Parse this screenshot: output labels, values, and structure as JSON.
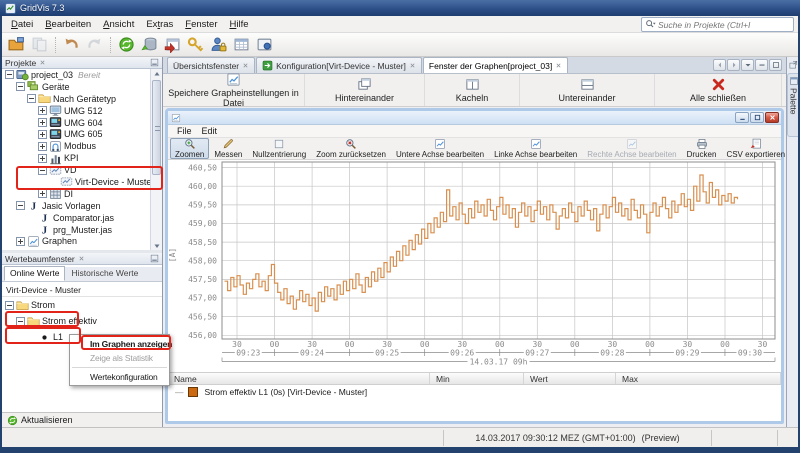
{
  "window": {
    "title": "GridVis 7.3"
  },
  "menubar": {
    "items": [
      {
        "label": "Datei",
        "accel": 0
      },
      {
        "label": "Bearbeiten",
        "accel": 0
      },
      {
        "label": "Ansicht",
        "accel": 0
      },
      {
        "label": "Extras",
        "accel": 2
      },
      {
        "label": "Fenster",
        "accel": 0
      },
      {
        "label": "Hilfe",
        "accel": 0
      }
    ]
  },
  "search": {
    "placeholder": "Suche in Projekte (Ctrl+I"
  },
  "main_toolbar": {
    "groups": [
      2,
      2,
      7
    ],
    "items": [
      {
        "name": "open-project",
        "icon": "open-project"
      },
      {
        "name": "copy",
        "icon": "copy",
        "disabled": true
      },
      {
        "name": "undo",
        "icon": "undo"
      },
      {
        "name": "redo",
        "icon": "redo",
        "disabled": true
      },
      {
        "name": "refresh",
        "icon": "refresh"
      },
      {
        "name": "db-sync",
        "icon": "dbsync"
      },
      {
        "name": "import-window",
        "icon": "importwin"
      },
      {
        "name": "key",
        "icon": "key"
      },
      {
        "name": "user-lock",
        "icon": "userlock"
      },
      {
        "name": "table",
        "icon": "tableicon"
      },
      {
        "name": "panel",
        "icon": "panelicon"
      }
    ]
  },
  "projekte_panel": {
    "title": "Projekte",
    "tree": [
      {
        "label": "project_03",
        "suffix": "Bereit",
        "icon": "project",
        "depth": 0,
        "expander": "minus"
      },
      {
        "label": "Geräte",
        "icon": "devices",
        "depth": 1,
        "expander": "minus"
      },
      {
        "label": "Nach Gerätetyp",
        "icon": "folder",
        "depth": 2,
        "expander": "minus"
      },
      {
        "label": "UMG 512",
        "icon": "monitor",
        "depth": 3,
        "expander": "plus"
      },
      {
        "label": "UMG 604",
        "icon": "umg",
        "depth": 3,
        "expander": "plus"
      },
      {
        "label": "UMG 605",
        "icon": "umg",
        "depth": 3,
        "expander": "plus"
      },
      {
        "label": "Modbus",
        "icon": "modbus",
        "depth": 3,
        "expander": "plus"
      },
      {
        "label": "KPI",
        "icon": "kpi",
        "depth": 3,
        "expander": "plus"
      },
      {
        "label": "VD",
        "icon": "vd",
        "depth": 3,
        "expander": "minus",
        "highlight": true
      },
      {
        "label": "Virt-Device - Muster",
        "icon": "vd",
        "depth": 4,
        "highlight": true
      },
      {
        "label": "DI",
        "icon": "di",
        "depth": 3,
        "expander": "plus"
      },
      {
        "label": "Jasic Vorlagen",
        "icon": "jasic",
        "depth": 1,
        "expander": "minus"
      },
      {
        "label": "Comparator.jas",
        "icon": "jasic",
        "depth": 2
      },
      {
        "label": "prg_Muster.jas",
        "icon": "jasic",
        "depth": 2
      },
      {
        "label": "Graphen",
        "icon": "chartpage",
        "depth": 1,
        "expander": "plus"
      }
    ]
  },
  "werte_panel": {
    "title": "Wertebaumfenster",
    "tabs": [
      "Online Werte",
      "Historische Werte"
    ],
    "active_tab": 0,
    "device_label": "Virt-Device - Muster",
    "tree": [
      {
        "label": "Strom",
        "icon": "folder",
        "depth": 0,
        "expander": "minus"
      },
      {
        "label": "Strom effektiv",
        "icon": "folder",
        "depth": 1,
        "expander": "minus",
        "highlight": true
      },
      {
        "label": "L1",
        "icon": "dot",
        "depth": 2,
        "highlight": true
      }
    ],
    "refresh_button": "Aktualisieren"
  },
  "context_menu": {
    "items": [
      {
        "label": "Im Graphen anzeigen",
        "bold": true,
        "highlight": true
      },
      {
        "label": "Zeige als Statistik",
        "disabled": true
      },
      {
        "sep": true
      },
      {
        "label": "Wertekonfiguration"
      }
    ]
  },
  "doc_tabs": [
    {
      "label": "Übersichtsfenster"
    },
    {
      "label": "Konfiguration[Virt-Device - Muster]",
      "icon": "config"
    },
    {
      "label": "Fenster der Graphen[project_03]",
      "active": true
    }
  ],
  "tab_controls": [
    {
      "name": "scroll-tabs-left",
      "icon": "trileft"
    },
    {
      "name": "scroll-tabs-right",
      "icon": "triright"
    },
    {
      "name": "tab-list-dropdown",
      "icon": "tridown"
    },
    {
      "name": "minimize-group",
      "icon": "dash"
    },
    {
      "name": "maximize-group",
      "icon": "maxi"
    }
  ],
  "graph_actions": [
    {
      "label": "Speichere Grapheinstellungen in Datei",
      "icon": "chartpage"
    },
    {
      "label": "Hintereinander",
      "icon": "cascade"
    },
    {
      "label": "Kacheln",
      "icon": "tile"
    },
    {
      "label": "Untereinander",
      "icon": "hsplit"
    },
    {
      "label": "Alle schließen",
      "icon": "closered"
    }
  ],
  "graph_window": {
    "menu": [
      "File",
      "Edit"
    ],
    "toolbar": [
      {
        "label": "Zoomen",
        "icon": "zoomin",
        "pressed": true
      },
      {
        "label": "Messen",
        "icon": "measure"
      },
      {
        "label": "Nullzentrierung",
        "icon": "checkbox"
      },
      {
        "label": "Zoom zurücksetzen",
        "icon": "zoomreset"
      },
      {
        "label": "Untere Achse bearbeiten",
        "icon": "axis"
      },
      {
        "label": "Linke Achse bearbeiten",
        "icon": "axis"
      },
      {
        "label": "Rechte Achse bearbeiten",
        "icon": "axis",
        "disabled": true
      },
      {
        "label": "Drucken",
        "icon": "print"
      },
      {
        "label": "CSV exportieren",
        "icon": "csv"
      }
    ],
    "table": {
      "columns": [
        "Name",
        "Min",
        "Wert",
        "Max"
      ],
      "rows": [
        {
          "name": "Strom effektiv L1 (0s) [Virt-Device - Muster]",
          "swatch": "#cb6a10",
          "min": "",
          "wert": "",
          "max": ""
        }
      ]
    }
  },
  "chart_data": {
    "type": "line",
    "line_style": "step-after",
    "ylabel": "[A]",
    "ylim": [
      455.9,
      460.65
    ],
    "y_ticks": [
      456.0,
      456.5,
      457.0,
      457.5,
      458.0,
      458.5,
      459.0,
      459.5,
      460.0,
      460.5
    ],
    "x_start": "09:23:18",
    "x_end": "09:30:40",
    "x_minor_tick_labels": [
      "30",
      "00",
      "30",
      "00",
      "30",
      "00",
      "30",
      "00",
      "30",
      "00",
      "30",
      "00",
      "30",
      "00",
      "30"
    ],
    "x_minute_labels": [
      "09:23",
      "09:24",
      "09:25",
      "09:26",
      "09:27",
      "09:28",
      "09:29",
      "09:30"
    ],
    "x_date_label": "14.03.17 09h",
    "grid": true,
    "series": [
      {
        "name": "Strom effektiv L1 (0s) [Virt-Device - Muster]",
        "color": "#d79050",
        "start": "09:23:20",
        "interval_s": 2.5,
        "values": [
          457.45,
          457.2,
          457.55,
          457.3,
          457.6,
          457.35,
          457.1,
          457.4,
          457.25,
          457.5,
          457.65,
          457.3,
          457.45,
          457.2,
          457.6,
          457.9,
          457.4,
          457.15,
          456.95,
          457.25,
          456.85,
          457.05,
          456.7,
          456.95,
          457.2,
          456.9,
          457.1,
          456.8,
          457.0,
          456.65,
          457.15,
          456.9,
          457.3,
          457.05,
          457.25,
          456.95,
          457.35,
          457.1,
          457.45,
          457.2,
          457.5,
          457.25,
          457.65,
          457.35,
          457.15,
          457.55,
          457.3,
          457.7,
          457.45,
          457.8,
          457.55,
          457.95,
          457.7,
          458.1,
          457.85,
          458.25,
          458.0,
          458.4,
          458.15,
          458.55,
          458.3,
          458.7,
          458.45,
          458.85,
          458.6,
          459.0,
          458.75,
          459.15,
          458.9,
          459.3,
          459.05,
          459.9,
          459.2,
          459.45,
          459.1,
          459.55,
          459.25,
          459.0,
          459.4,
          459.15,
          459.6,
          459.3,
          459.5,
          459.2,
          459.65,
          459.35,
          459.1,
          459.45,
          459.7,
          459.25,
          459.5,
          459.15,
          459.4,
          458.9,
          459.3,
          459.55,
          459.2,
          459.45,
          459.05,
          459.35,
          459.6,
          459.25,
          459.45,
          459.1,
          459.5,
          459.3,
          458.85,
          459.2,
          459.4,
          459.15,
          459.55,
          459.3,
          459.05,
          459.45,
          459.2,
          459.6,
          459.35,
          459.1,
          459.4,
          458.8,
          459.25,
          459.5,
          459.15,
          459.45,
          459.7,
          459.3,
          459.55,
          459.2,
          459.4,
          459.1,
          459.65,
          459.35,
          459.15,
          459.5,
          459.25,
          458.75,
          459.3,
          459.55,
          459.2,
          459.45,
          459.7,
          459.4,
          459.15,
          459.6,
          459.3,
          459.5,
          459.8,
          459.45,
          459.65,
          459.35,
          460.0,
          459.6,
          460.3,
          459.85,
          459.55,
          460.1,
          459.7,
          459.9,
          459.5,
          459.75,
          459.6,
          459.8,
          459.55,
          459.7,
          459.65
        ]
      }
    ]
  },
  "status_bar": {
    "time": "14.03.2017 09:30:12 MEZ (GMT+01:00)",
    "preview": "(Preview)"
  },
  "palette_tab": {
    "label": "Palette"
  },
  "annotation": {
    "color": "#e2231a",
    "highlighted": [
      "VD",
      "Virt-Device - Muster",
      "Strom effektiv",
      "L1",
      "Im Graphen anzeigen"
    ]
  }
}
